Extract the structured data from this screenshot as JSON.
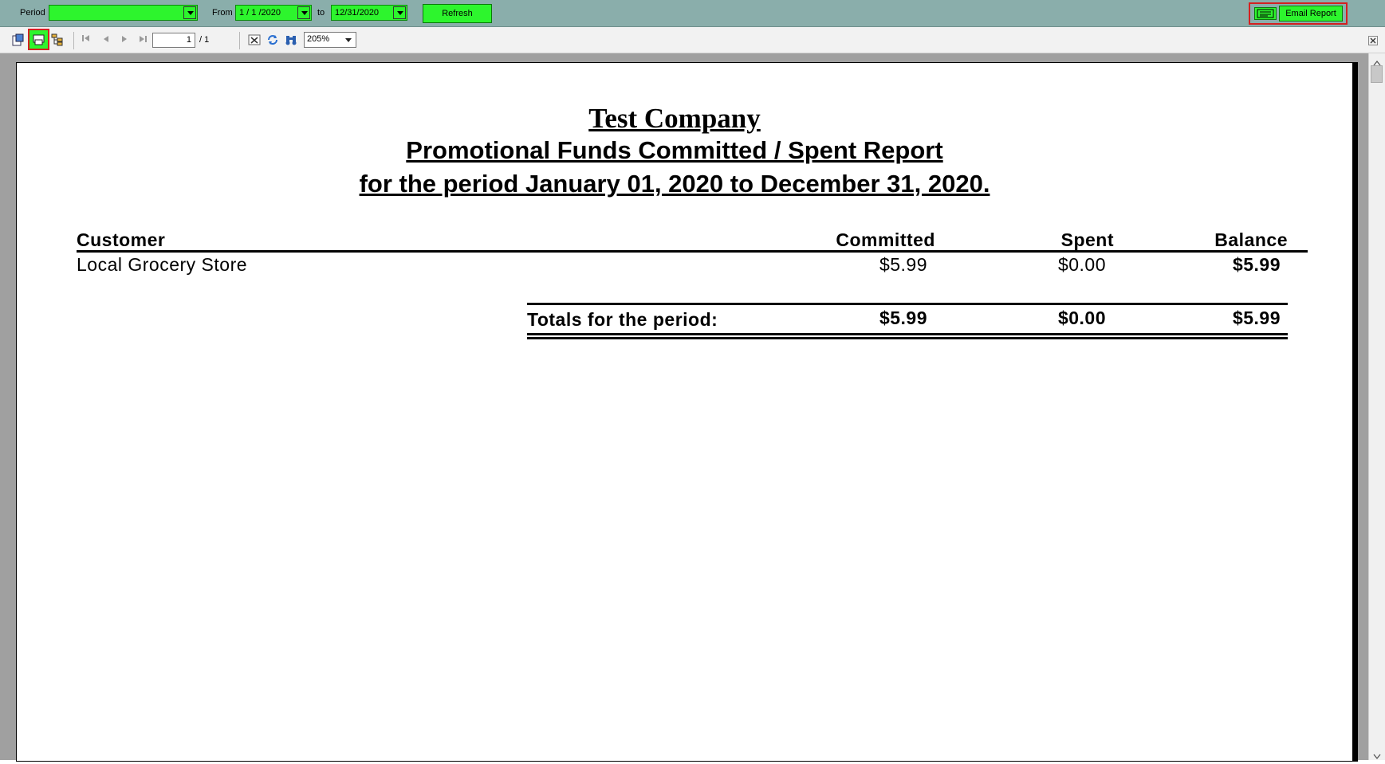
{
  "params": {
    "period_label": "Period",
    "period_value": "",
    "from_label": "From",
    "from_value": "1 / 1 /2020",
    "to_label": "to",
    "to_value": "12/31/2020",
    "refresh_label": "Refresh",
    "email_label": "Email Report"
  },
  "toolbar": {
    "page_current": "1",
    "page_total": "/ 1",
    "zoom": "205%"
  },
  "report": {
    "company": "Test Company",
    "title": "Promotional Funds Committed / Spent Report",
    "period": "for the period January 01, 2020 to December 31, 2020.",
    "columns": {
      "customer": "Customer",
      "committed": "Committed",
      "spent": "Spent",
      "balance": "Balance"
    },
    "rows": [
      {
        "customer": "Local Grocery Store",
        "committed": "$5.99",
        "spent": "$0.00",
        "balance": "$5.99"
      }
    ],
    "totals": {
      "label": "Totals for the period:",
      "committed": "$5.99",
      "spent": "$0.00",
      "balance": "$5.99"
    }
  },
  "colors": {
    "param_bar": "#8aaeab",
    "highlight_green": "#2df52d",
    "highlight_red": "#d42020",
    "viewer_bg": "#a0a0a0"
  }
}
